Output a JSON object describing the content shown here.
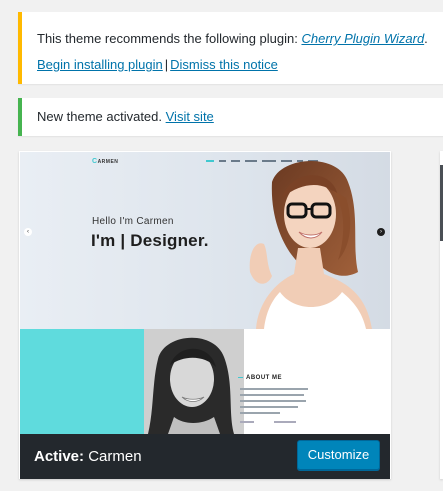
{
  "notices": {
    "plugin": {
      "text": "This theme recommends the following plugin: ",
      "plugin_link": "Cherry Plugin Wizard",
      "period": ".",
      "install_link": "Begin installing plugin",
      "separator": "|",
      "dismiss_link": "Dismiss this notice"
    },
    "activated": {
      "text": "New theme activated. ",
      "visit_link": "Visit site"
    }
  },
  "theme": {
    "preview": {
      "logo_initial": "C",
      "logo_rest": "ARMEN",
      "hello": "Hello I'm Carmen",
      "headline": "I'm  | Designer.",
      "about_heading": "ABOUT ME"
    },
    "active_label": "Active:",
    "name": "Carmen",
    "customize_label": "Customize"
  },
  "colors": {
    "warning": "#ffb900",
    "success": "#46b450",
    "link": "#0073aa",
    "primary_button": "#0085ba",
    "footer": "#23282d",
    "preview_accent": "#5fdbdd"
  },
  "icons": {
    "slider_prev": "chevron-left-icon",
    "slider_next": "chevron-right-icon"
  }
}
